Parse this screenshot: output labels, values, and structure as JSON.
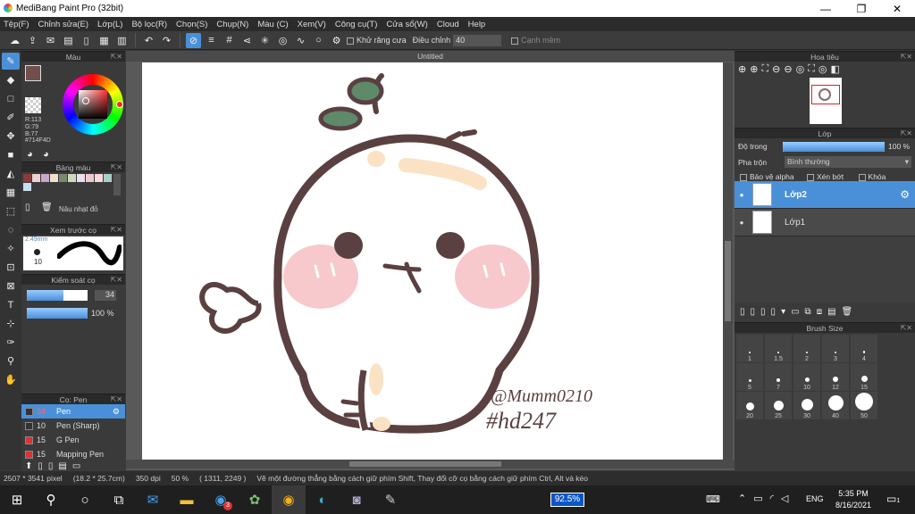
{
  "window": {
    "title": "MediBang Paint Pro (32bit)",
    "min": "—",
    "max": "❐",
    "close": "✕"
  },
  "menu": [
    "Tệp(F)",
    "Chỉnh sửa(E)",
    "Lớp(L)",
    "Bộ lọc(R)",
    "Chọn(S)",
    "Chụp(N)",
    "Màu (C)",
    "Xem(V)",
    "Công cụ(T)",
    "Cửa sổ(W)",
    "Cloud",
    "Help"
  ],
  "toolbar": {
    "antialias_label": "Khử răng cưa",
    "adjust_label": "Điều chỉnh",
    "adjust_value": "40",
    "edge_label": "Cạnh mềm"
  },
  "color_panel": {
    "title": "Màu",
    "r": "R:113",
    "g": "G:79",
    "b": "B:77",
    "hex": "#714F4D",
    "color": "#714F4D"
  },
  "palette_panel": {
    "title": "Bảng màu",
    "darken_label": "Nâu nhạt đỏ"
  },
  "brush_preview": {
    "title": "Xem trước cọ",
    "size": "2.49mm",
    "size_value": "10"
  },
  "brush_control": {
    "title": "Kiểm soát cọ",
    "size_value": "34",
    "opacity_value": "100 %",
    "size_level": 0.6,
    "opacity_level": 1.0
  },
  "brush_list": {
    "title": "Cọ: Pen",
    "items": [
      {
        "size": "34",
        "name": "Pen",
        "color": "#333333",
        "selected": true
      },
      {
        "size": "10",
        "name": "Pen (Sharp)",
        "color": "#333333",
        "selected": false
      },
      {
        "size": "15",
        "name": "G Pen",
        "color": "#e03030",
        "selected": false
      },
      {
        "size": "15",
        "name": "Mapping Pen",
        "color": "#e03030",
        "selected": false
      }
    ]
  },
  "document": {
    "tab": "Untitled"
  },
  "drawing": {
    "signature_line1": "@Mumm0210",
    "signature_line2": "#hd247"
  },
  "navigator": {
    "title": "Hoa tiêu"
  },
  "layers_panel": {
    "title": "Lớp",
    "opacity_label": "Độ trong",
    "opacity_value": "100 %",
    "opacity_level": 1.0,
    "blend_label": "Pha trộn",
    "blend_value": "Bình thường",
    "protect_alpha": "Bảo vệ alpha",
    "clipping": "Xén bớt",
    "lock": "Khóa",
    "layers": [
      {
        "name": "Lớp2",
        "selected": true
      },
      {
        "name": "Lớp1",
        "selected": false
      }
    ]
  },
  "brush_size_panel": {
    "title": "Brush Size",
    "sizes": [
      "1",
      "1.5",
      "2",
      "3",
      "4",
      "5",
      "7",
      "10",
      "12",
      "15",
      "20",
      "25",
      "30",
      "40",
      "50"
    ]
  },
  "status": {
    "size": "2507 * 3541 pixel",
    "cm": "(18.2 * 25.7cm)",
    "dpi": "350 dpi",
    "zoom": "50 %",
    "coords": "( 1311, 2249 )",
    "hint": "Vẽ một đường thẳng bằng cách giữ phím Shift, Thay đổi cỡ cọ bằng cách giữ phím Ctrl, Alt và kéo"
  },
  "taskbar": {
    "zoom_badge": "92.5%",
    "lang": "ENG",
    "time": "5:35 PM",
    "date": "8/16/2021",
    "notif_count": "3",
    "chat_badge": "1"
  },
  "palette_colors": [
    "#8a3a3a",
    "#f0d0d0",
    "#c8a8c8",
    "#f4e0c8",
    "#7a8a70",
    "#d0d8c0",
    "#e8e0f0",
    "#f0c8d0",
    "#f8d8d8",
    "#a8d0c8",
    "#c8e0f0"
  ],
  "icons": [
    "brush-icon",
    "eraser-icon",
    "select-rect-icon",
    "pen-icon",
    "move-icon",
    "fill-icon",
    "bucket-icon",
    "gradient-icon",
    "lasso-icon",
    "magic-wand-icon",
    "text-icon",
    "hand-icon"
  ]
}
